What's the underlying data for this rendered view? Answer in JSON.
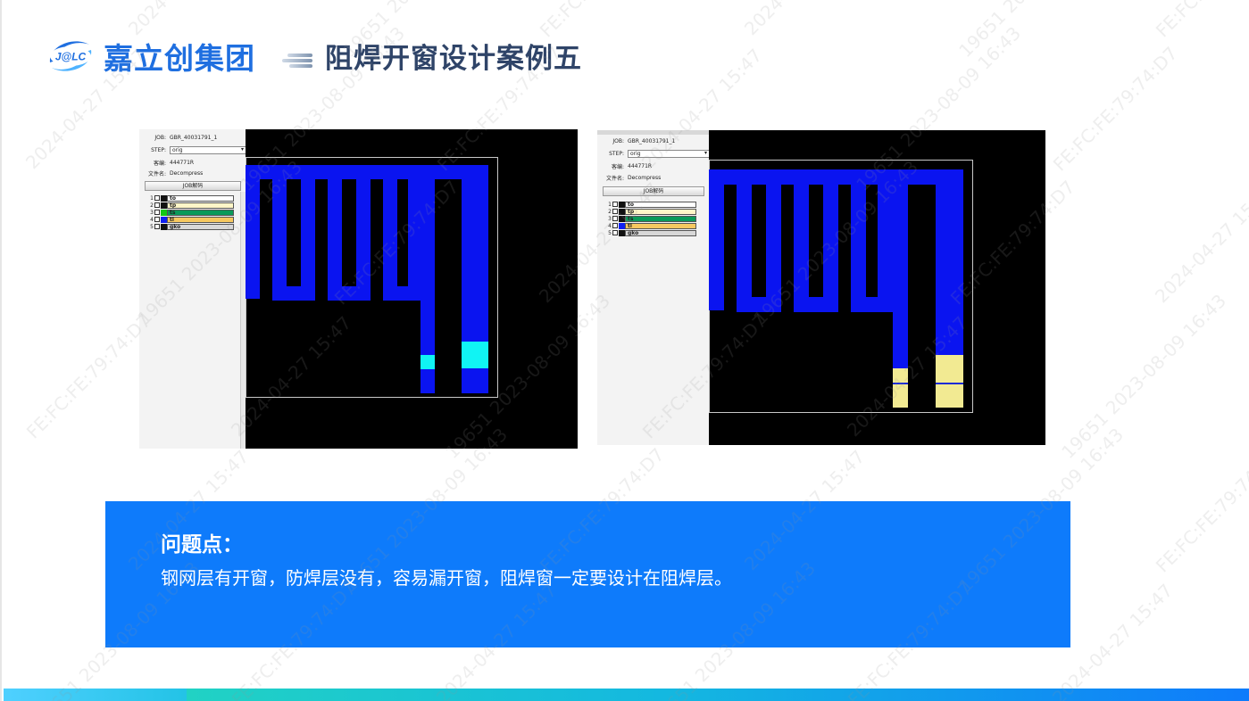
{
  "header": {
    "logo_text": "J@LC",
    "brand_name": "嘉立创集团",
    "slide_title": "阻焊开窗设计案例五"
  },
  "left_screenshot": {
    "job_label": "JOB:",
    "job_value": "GBR_40031791_1",
    "step_label": "STEP:",
    "step_value": "orig",
    "customer_label": "客编:",
    "customer_value": "444771R",
    "file_label": "文件名:",
    "file_value": "Decompress",
    "job_button": "JOB解码",
    "layers": [
      {
        "num": "1",
        "name": "to",
        "swatch": "#111111",
        "bar": "#ffffff"
      },
      {
        "num": "2",
        "name": "tp",
        "swatch": "#111111",
        "bar": "#fff6c8"
      },
      {
        "num": "3",
        "name": "ts",
        "swatch": "#14c814",
        "bar": "#0a9a5a"
      },
      {
        "num": "4",
        "name": "tl",
        "swatch": "#1020f0",
        "bar": "#f6c860"
      },
      {
        "num": "5",
        "name": "gko",
        "swatch": "#111111",
        "bar": "#d8d8d8"
      }
    ]
  },
  "right_screenshot": {
    "toolbar_value": "None",
    "job_label": "JOB:",
    "job_value": "GBR_40031791_1",
    "step_label": "STEP:",
    "step_value": "orig",
    "customer_label": "客编:",
    "customer_value": "444771R",
    "file_label": "文件名:",
    "file_value": "Decompress",
    "job_button": "JOB解码",
    "layers": [
      {
        "num": "1",
        "name": "to",
        "swatch": "#111111",
        "bar": "#ffffff"
      },
      {
        "num": "2",
        "name": "tp",
        "swatch": "#111111",
        "bar": "#fff6c8"
      },
      {
        "num": "3",
        "name": "ts",
        "swatch": "#111111",
        "bar": "#0a9a5a"
      },
      {
        "num": "4",
        "name": "tl",
        "swatch": "#1020f0",
        "bar": "#f6c860"
      },
      {
        "num": "5",
        "name": "gko",
        "swatch": "#111111",
        "bar": "#d8d8d8"
      }
    ]
  },
  "problem": {
    "title": "问题点：",
    "text": "钢网层有开窗，防焊层没有，容易漏开窗，阻焊窗一定要设计在阻焊层。"
  },
  "watermark": {
    "lines": [
      "FE:FC:FE:79:74:D7",
      "2024-04-27  15:47",
      "19651  2023-08-09  16:43"
    ]
  },
  "colors": {
    "brand_blue": "#1f6fe0",
    "title_navy": "#2f4468",
    "problem_bg": "#0e7bfb",
    "copper_blue": "#0a14f0",
    "mask_cyan": "#10f4f4",
    "paste_yellow": "#f2ea92"
  }
}
